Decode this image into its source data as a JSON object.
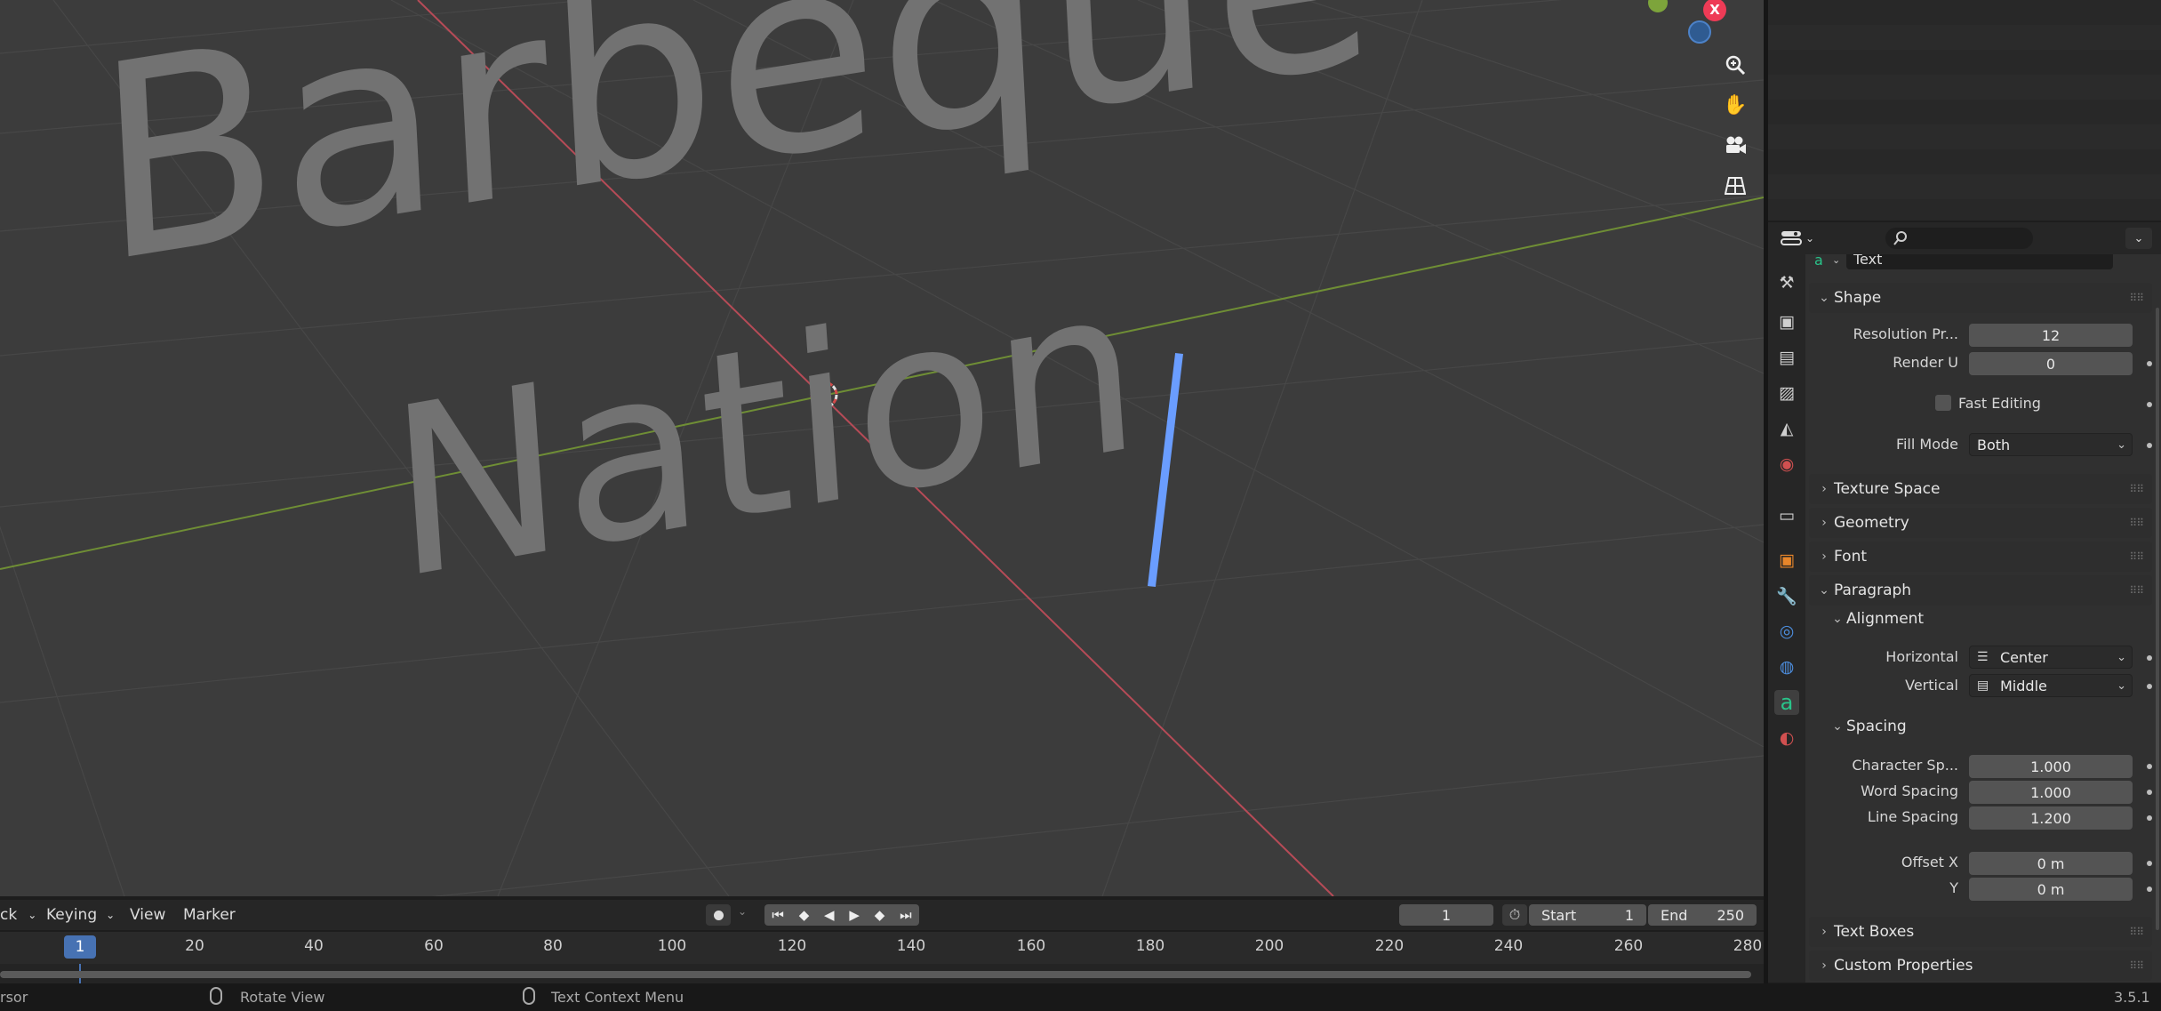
{
  "viewport": {
    "text_line1": "Barbeque",
    "text_line2": "Nation",
    "nav_icons": [
      "zoom-icon",
      "pan-hand-icon",
      "camera-icon",
      "grid-view-icon"
    ],
    "gizmo_x_label": "X"
  },
  "properties": {
    "search_placeholder": "",
    "datablock_name": "Text",
    "panels": {
      "shape": "Shape",
      "texture_space": "Texture Space",
      "geometry": "Geometry",
      "font": "Font",
      "paragraph": "Paragraph",
      "alignment": "Alignment",
      "spacing": "Spacing",
      "text_boxes": "Text Boxes",
      "custom_properties": "Custom Properties"
    },
    "shape": {
      "resolution_preview_label": "Resolution Pr...",
      "resolution_preview_value": "12",
      "render_u_label": "Render U",
      "render_u_value": "0",
      "fast_editing_label": "Fast Editing",
      "fill_mode_label": "Fill Mode",
      "fill_mode_value": "Both"
    },
    "alignment": {
      "horizontal_label": "Horizontal",
      "horizontal_value": "Center",
      "vertical_label": "Vertical",
      "vertical_value": "Middle"
    },
    "spacing": {
      "character_label": "Character Sp...",
      "character_value": "1.000",
      "word_label": "Word Spacing",
      "word_value": "1.000",
      "line_label": "Line Spacing",
      "line_value": "1.200",
      "offset_x_label": "Offset X",
      "offset_x_value": "0 m",
      "offset_y_label": "Y",
      "offset_y_value": "0 m"
    }
  },
  "timeline": {
    "menu_partial": "ck",
    "keying": "Keying",
    "view": "View",
    "marker": "Marker",
    "current_frame": "1",
    "start_label": "Start",
    "start_value": "1",
    "end_label": "End",
    "end_value": "250",
    "ruler_current": "1",
    "ruler_ticks": [
      "20",
      "40",
      "60",
      "80",
      "100",
      "120",
      "140",
      "160",
      "180",
      "200",
      "220",
      "240",
      "260",
      "280"
    ]
  },
  "statusbar": {
    "left_partial": "rsor",
    "rotate_view": "Rotate View",
    "text_context_menu": "Text Context Menu",
    "version": "3.5.1"
  },
  "colors": {
    "accent_blue": "#4772b3",
    "x_axis": "#b64b57",
    "y_axis": "#6f8e35",
    "text_cursor": "#6a9dff",
    "text_object": "#727272"
  }
}
